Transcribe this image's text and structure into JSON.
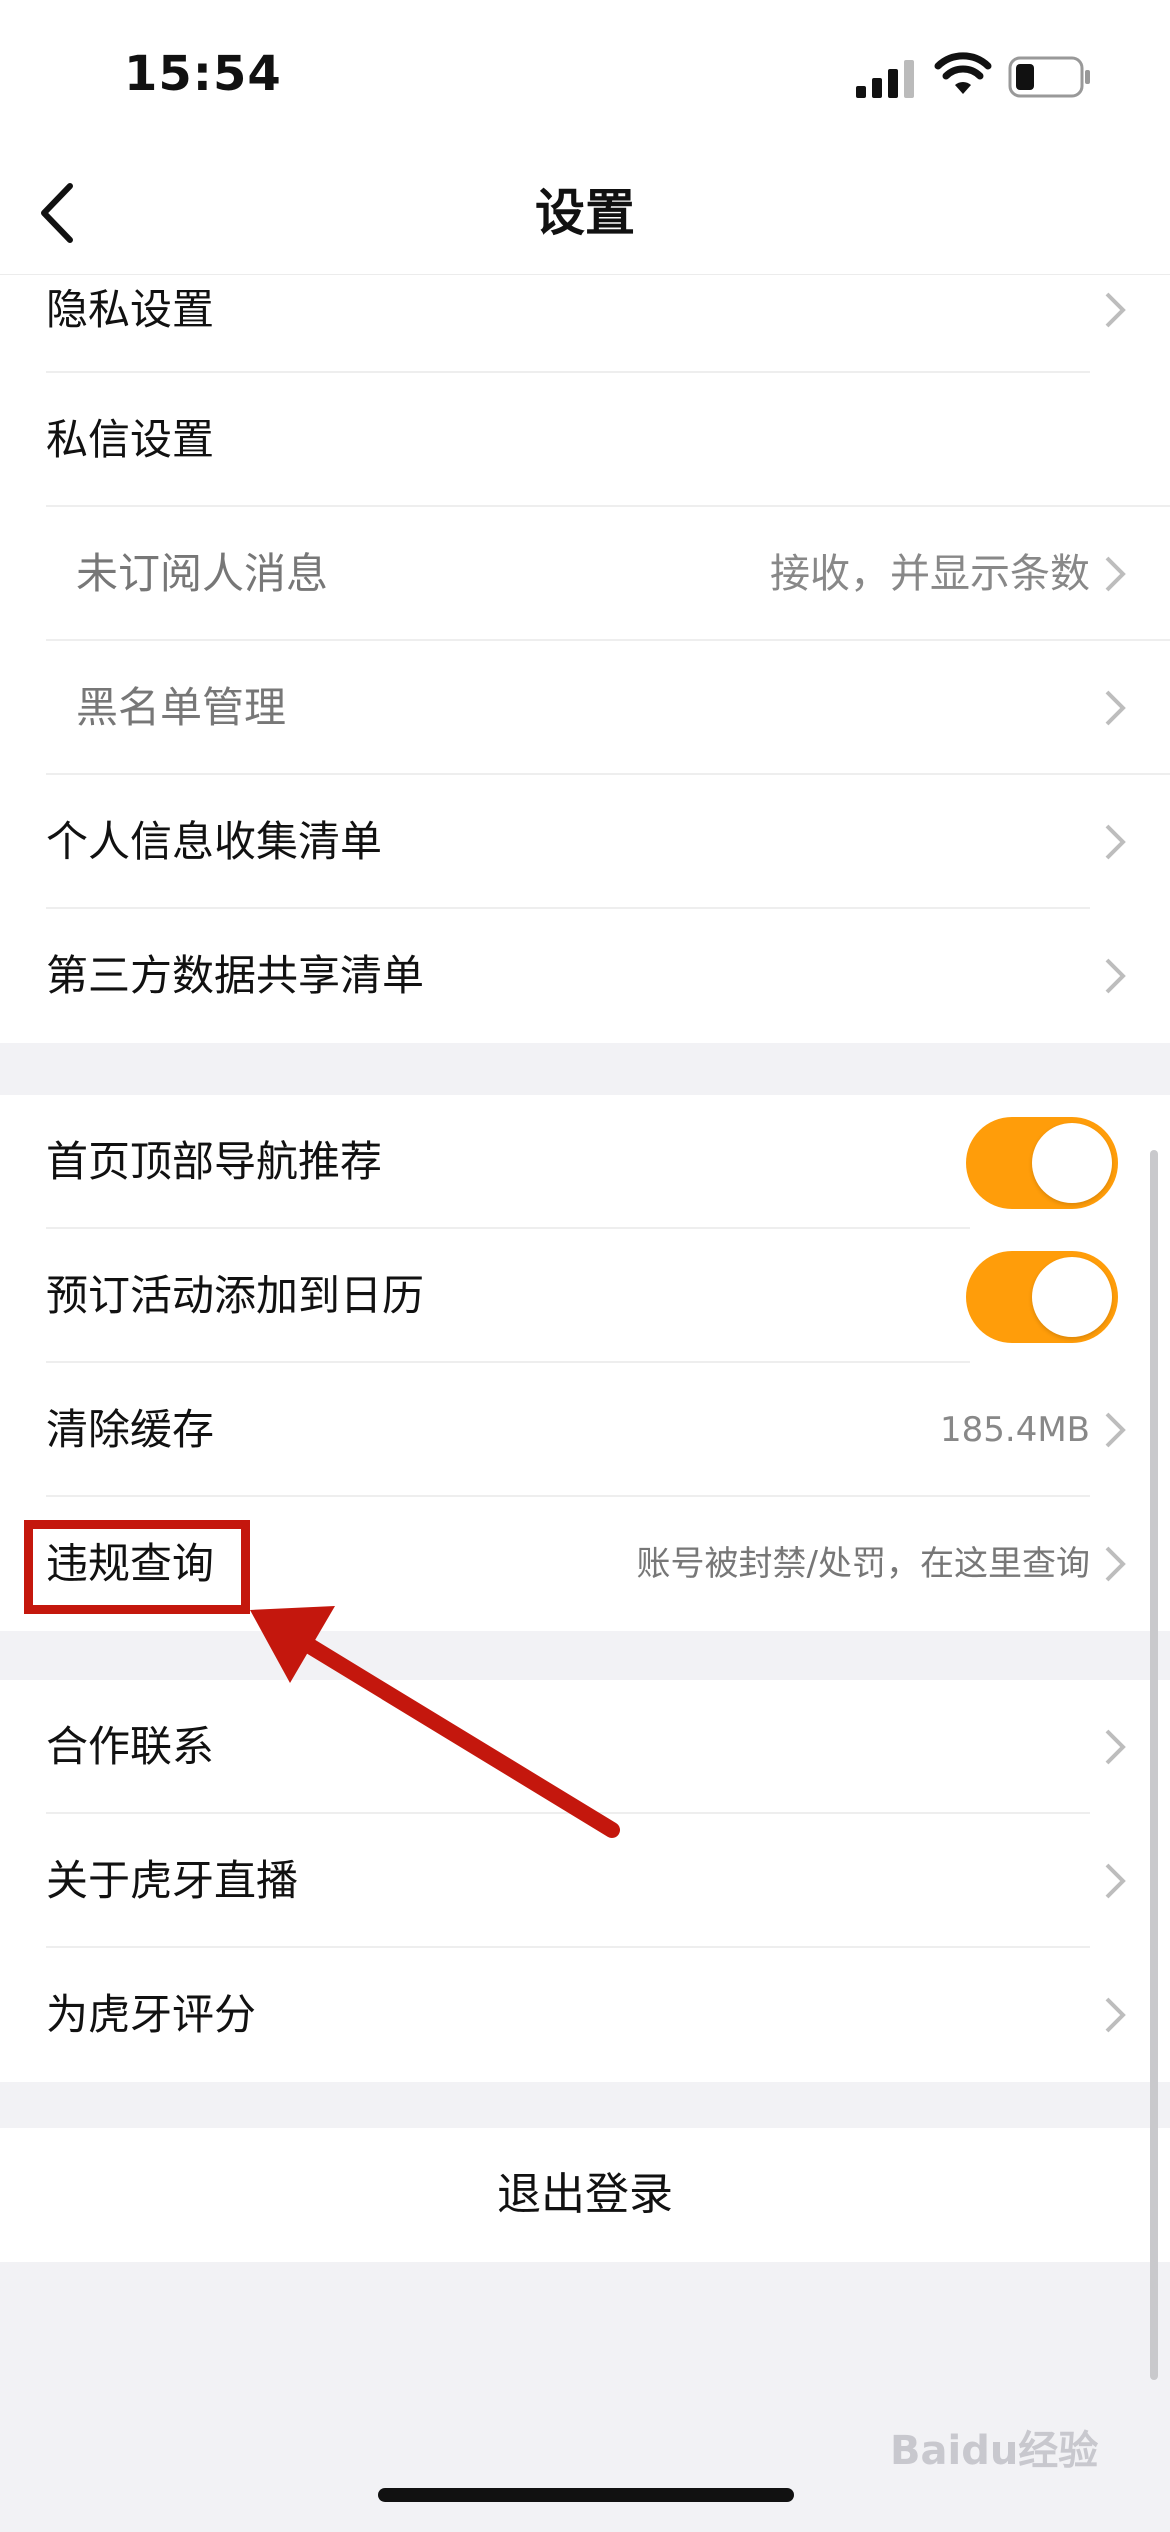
{
  "status": {
    "time": "15:54"
  },
  "nav": {
    "title": "设置"
  },
  "section1": {
    "privacy": "隐私设置",
    "dm": "私信设置",
    "unsub_msg": "未订阅人消息",
    "unsub_msg_value": "接收，并显示条数",
    "blacklist": "黑名单管理",
    "info_collect": "个人信息收集清单",
    "third_party": "第三方数据共享清单"
  },
  "section2": {
    "home_nav": "首页顶部导航推荐",
    "home_nav_on": true,
    "calendar": "预订活动添加到日历",
    "calendar_on": true,
    "clear_cache": "清除缓存",
    "cache_size": "185.4MB",
    "violation": "违规查询",
    "violation_hint": "账号被封禁/处罚，在这里查询"
  },
  "section3": {
    "cooperation": "合作联系",
    "about": "关于虎牙直播",
    "rate": "为虎牙评分"
  },
  "logout": "退出登录",
  "watermark": "Baidu经验",
  "colors": {
    "accent": "#ff9d0a",
    "annotation": "#c4170d"
  }
}
